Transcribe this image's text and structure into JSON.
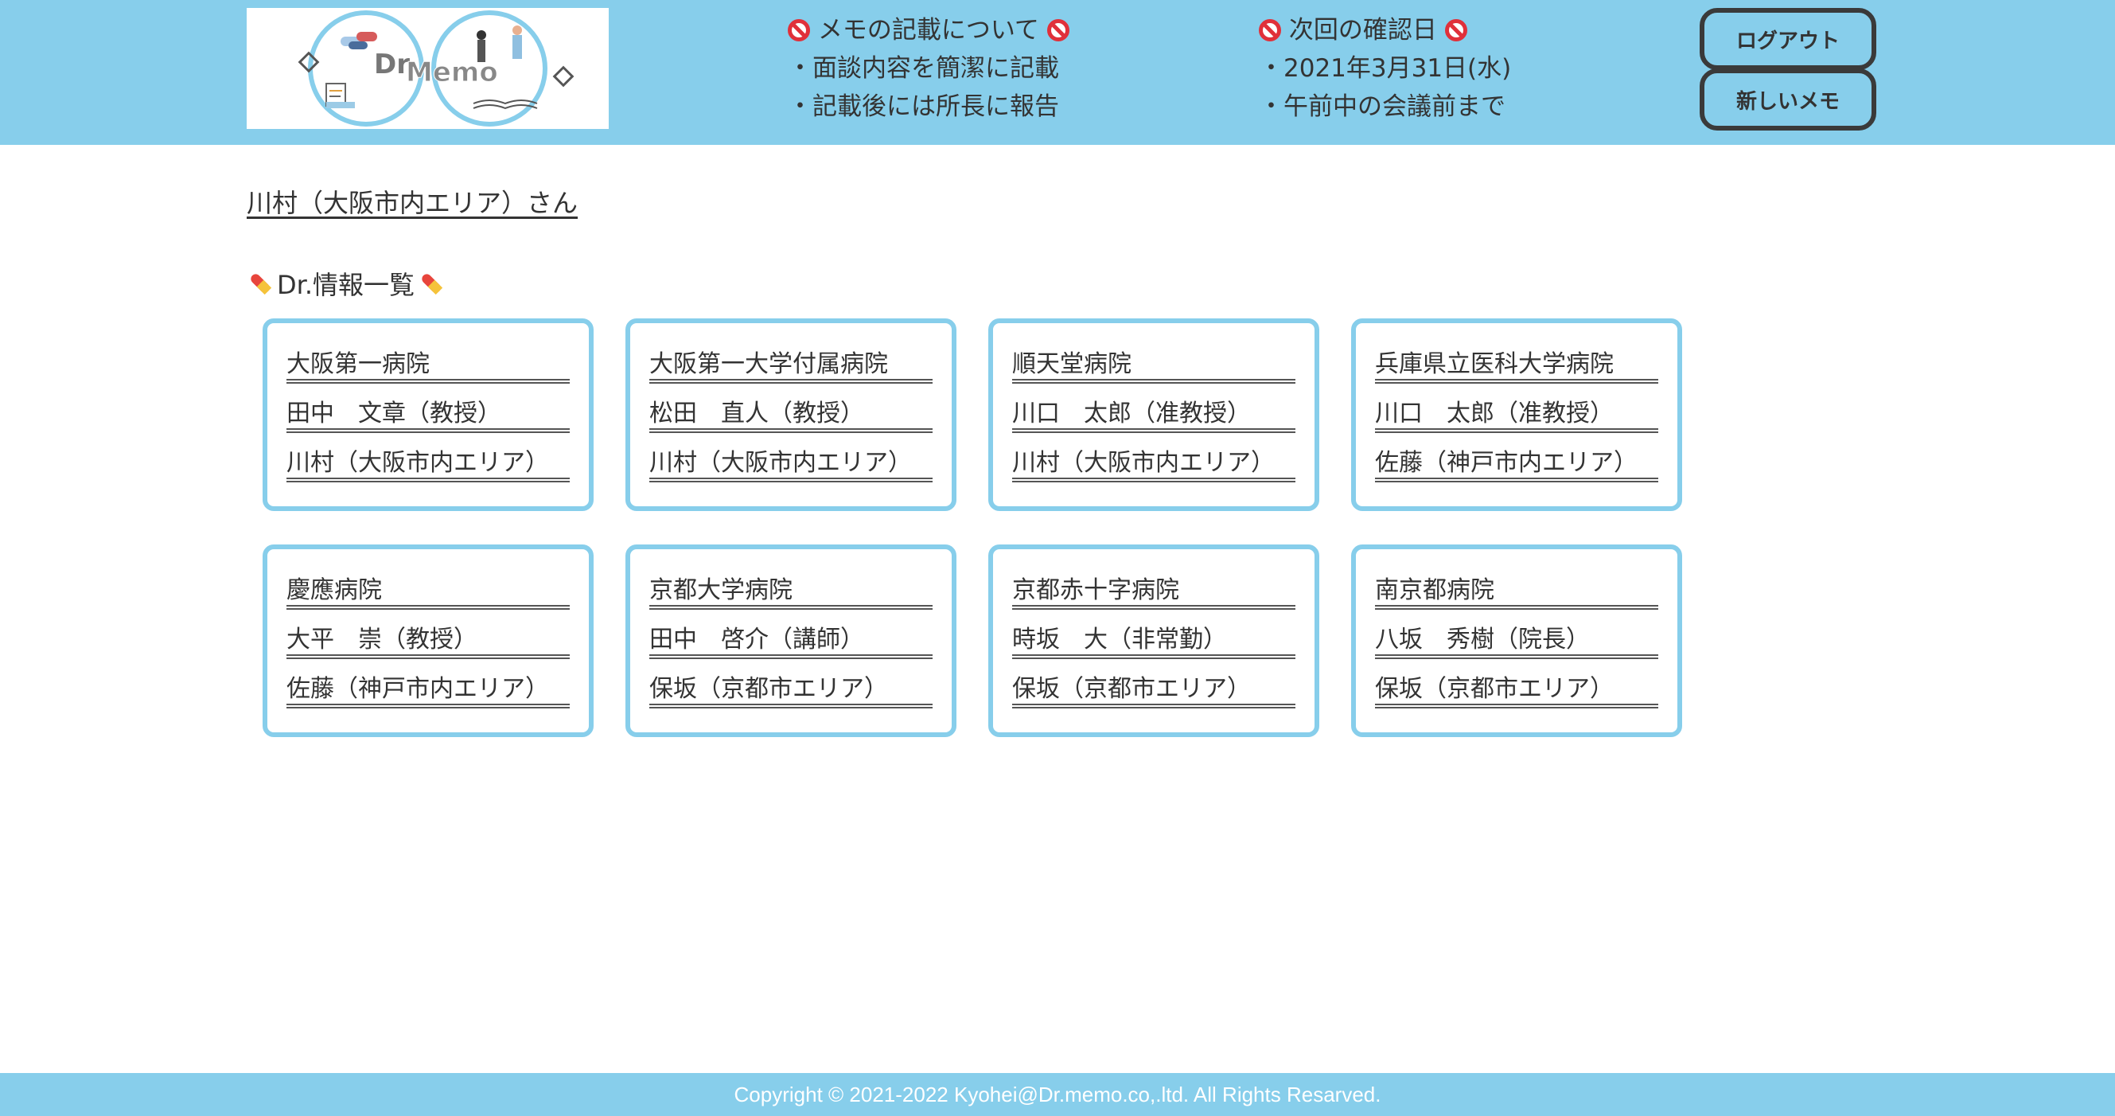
{
  "header": {
    "logo_text_left": "Dr.",
    "logo_text_right": "Memo",
    "notice_memo": {
      "title": "メモの記載について",
      "lines": [
        "・面談内容を簡潔に記載",
        "・記載後には所長に報告"
      ]
    },
    "notice_next_check": {
      "title": "次回の確認日",
      "lines": [
        "・2021年3月31日(水)",
        "・午前中の会議前まで"
      ]
    },
    "logout_label": "ログアウト",
    "new_memo_label": "新しいメモ"
  },
  "main": {
    "user_greeting": "川村（大阪市内エリア）さん",
    "section_title": "Dr.情報一覧",
    "doctors": [
      {
        "hospital": "大阪第一病院",
        "doctor": "田中　文章（教授）",
        "rep": "川村（大阪市内エリア）"
      },
      {
        "hospital": "大阪第一大学付属病院",
        "doctor": "松田　直人（教授）",
        "rep": "川村（大阪市内エリア）"
      },
      {
        "hospital": "順天堂病院",
        "doctor": "川口　太郎（准教授）",
        "rep": "川村（大阪市内エリア）"
      },
      {
        "hospital": "兵庫県立医科大学病院",
        "doctor": "川口　太郎（准教授）",
        "rep": "佐藤（神戸市内エリア）"
      },
      {
        "hospital": "慶應病院",
        "doctor": "大平　崇（教授）",
        "rep": "佐藤（神戸市内エリア）"
      },
      {
        "hospital": "京都大学病院",
        "doctor": "田中　啓介（講師）",
        "rep": "保坂（京都市エリア）"
      },
      {
        "hospital": "京都赤十字病院",
        "doctor": "時坂　大（非常勤）",
        "rep": "保坂（京都市エリア）"
      },
      {
        "hospital": "南京都病院",
        "doctor": "八坂　秀樹（院長）",
        "rep": "保坂（京都市エリア）"
      }
    ]
  },
  "footer": {
    "copyright": "Copyright © 2021-2022 Kyohei@Dr.memo.co,.ltd. All Rights Resarved."
  },
  "colors": {
    "header_bg": "#87ceeb",
    "card_border": "#87ceeb",
    "button_border": "#3a3a3a",
    "ban_icon": "#e0303a"
  },
  "icons": {
    "notice": "no-entry-icon",
    "section": "pill-icon"
  }
}
